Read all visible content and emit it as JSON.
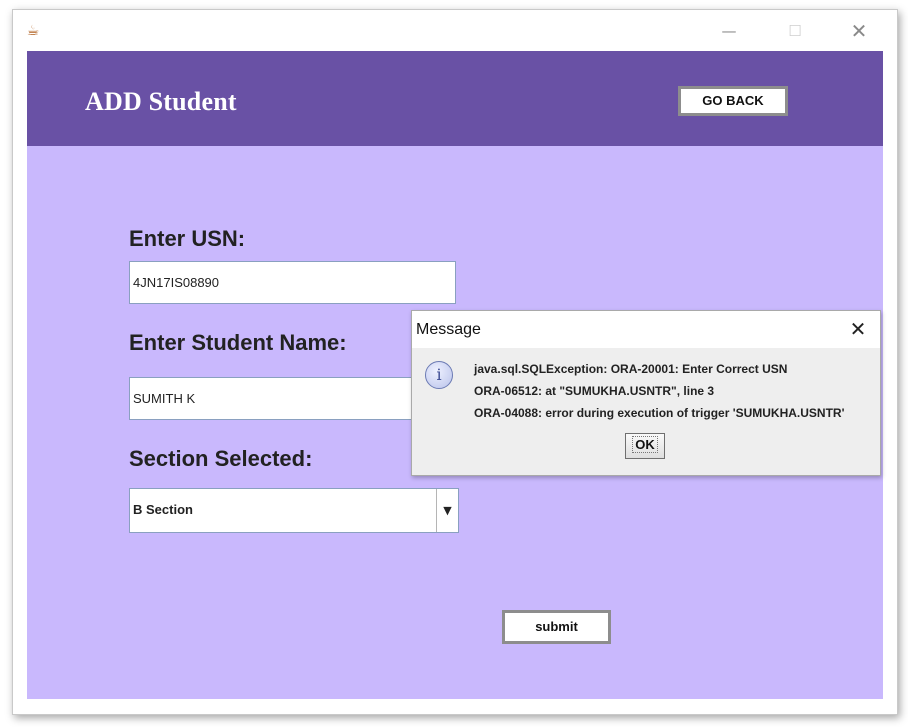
{
  "window": {
    "icon": "java-cup-icon",
    "controls": {
      "minimize": "—",
      "maximize": "☐",
      "close": "✕"
    }
  },
  "header": {
    "title": "ADD Student",
    "go_back_label": "GO BACK",
    "background": "#6951a5"
  },
  "form": {
    "usn_label": "Enter USN:",
    "usn_value": "4JN17IS08890",
    "name_label": "Enter Student Name:",
    "name_value": "SUMITH K",
    "section_label": "Section Selected:",
    "section_value": "B Section",
    "submit_label": "submit",
    "background": "#c9b8fd"
  },
  "dialog": {
    "title": "Message",
    "close_glyph": "✕",
    "icon": "info-icon",
    "icon_glyph": "i",
    "lines": [
      "java.sql.SQLException: ORA-20001: Enter Correct USN",
      "ORA-06512: at \"SUMUKHA.USNTR\", line 3",
      "ORA-04088: error during execution of trigger 'SUMUKHA.USNTR'"
    ],
    "ok_label": "OK"
  }
}
